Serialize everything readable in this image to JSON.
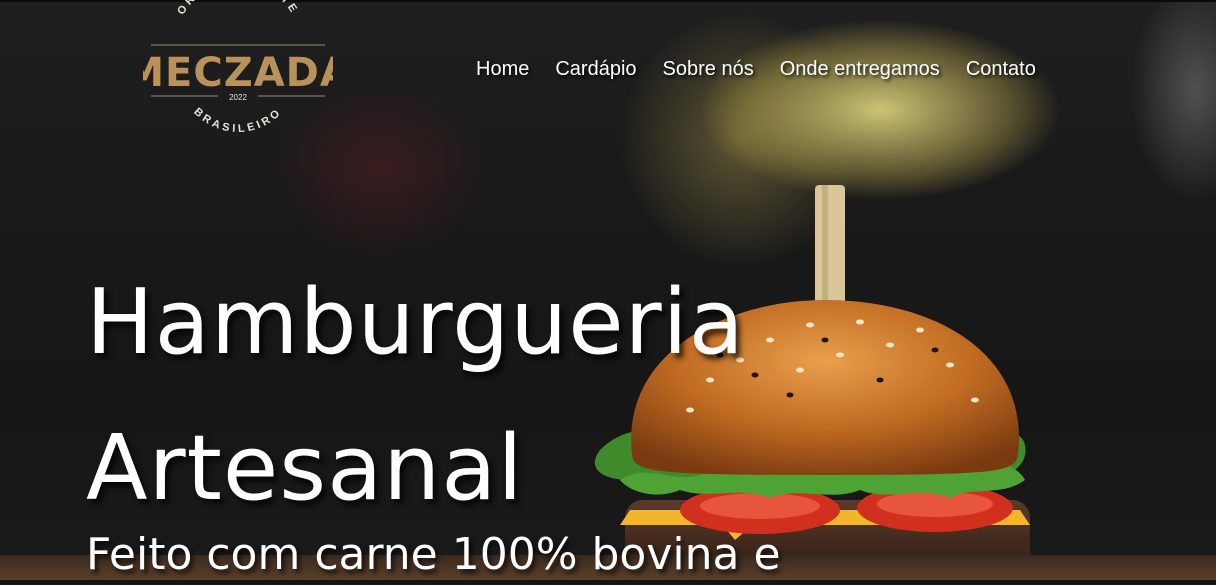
{
  "logo": {
    "top_arc_text": "ORIGINALMENTE",
    "name": "MECZADA",
    "year": "2022",
    "bottom_arc_text": "BRASILEIRO",
    "brand_color": "#b8925a"
  },
  "nav": {
    "items": [
      "Home",
      "Cardápio",
      "Sobre nós",
      "Onde entregamos",
      "Contato"
    ]
  },
  "hero": {
    "title_line1": "Hamburgueria",
    "title_line2": "Artesanal",
    "subtitle": "Feito com carne 100% bovina e"
  },
  "icons": [
    "burger-illustration"
  ]
}
